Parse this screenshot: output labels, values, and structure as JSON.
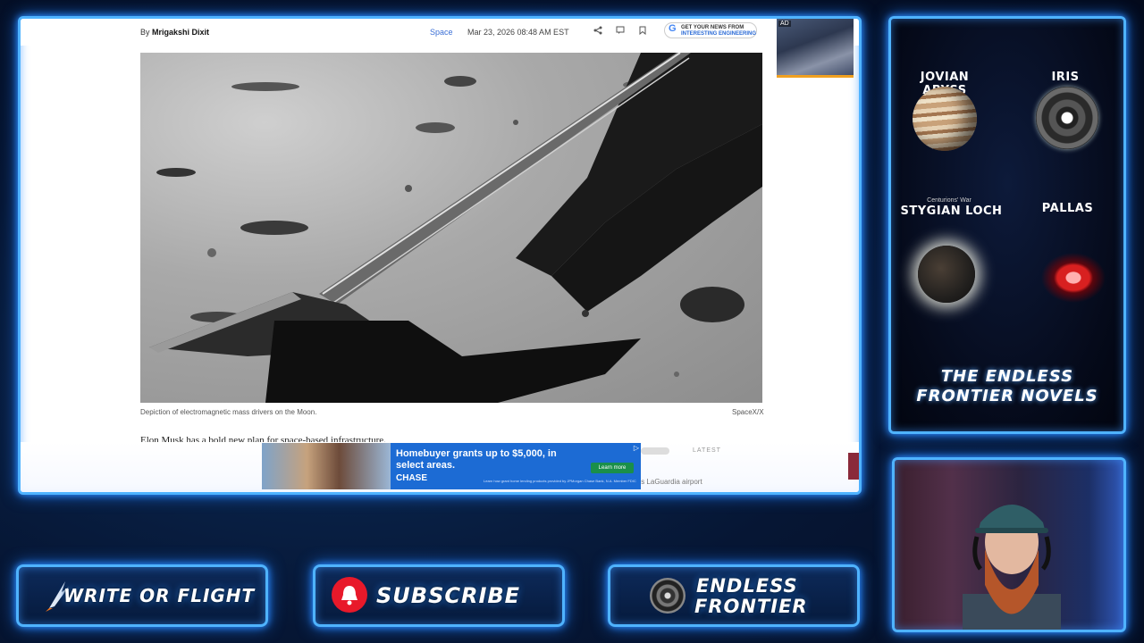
{
  "article": {
    "byline_prefix": "By",
    "author": "Mrigakshi Dixit",
    "section": "Space",
    "date": "Mar 23, 2026 08:48 AM EST",
    "google_badge": {
      "line1": "GET YOUR NEWS FROM",
      "line2": "INTERESTING ENGINEERING"
    },
    "ad_label": "AD",
    "image_caption": "Depiction of electromagnetic mass drivers on the Moon.",
    "image_credit": "SpaceX/X",
    "body_start": "Elon Musk has a bold new plan for space-based infrastructure.",
    "latest_label": "LATEST",
    "latest_item": "rk's LaGuardia airport"
  },
  "ad": {
    "headline": "Homebuyer grants up to $5,000, in select areas.",
    "brand": "CHASE",
    "cta": "Learn more",
    "fine_print": "Learn how grant home lending products provided by JPMorgan Chase Bank, N.A. Member FDIC"
  },
  "novels": {
    "books": [
      {
        "title": "JOVIAN ABYSS",
        "subtitle": ""
      },
      {
        "title": "IRIS",
        "subtitle": ""
      },
      {
        "title": "STYGIAN LOCH",
        "subtitle": "Centurions' War"
      },
      {
        "title": "PALLAS",
        "subtitle": ""
      }
    ],
    "footer_line1": "THE ENDLESS",
    "footer_line2": "FRONTIER NOVELS"
  },
  "buttons": {
    "write": "WRITE OR FLIGHT",
    "subscribe": "SUBSCRIBE",
    "frontier_line1": "ENDLESS",
    "frontier_line2": "FRONTIER"
  },
  "colors": {
    "neon": "#4fb3ff",
    "accent_red": "#e8192a",
    "chase_blue": "#1c6bd4"
  }
}
